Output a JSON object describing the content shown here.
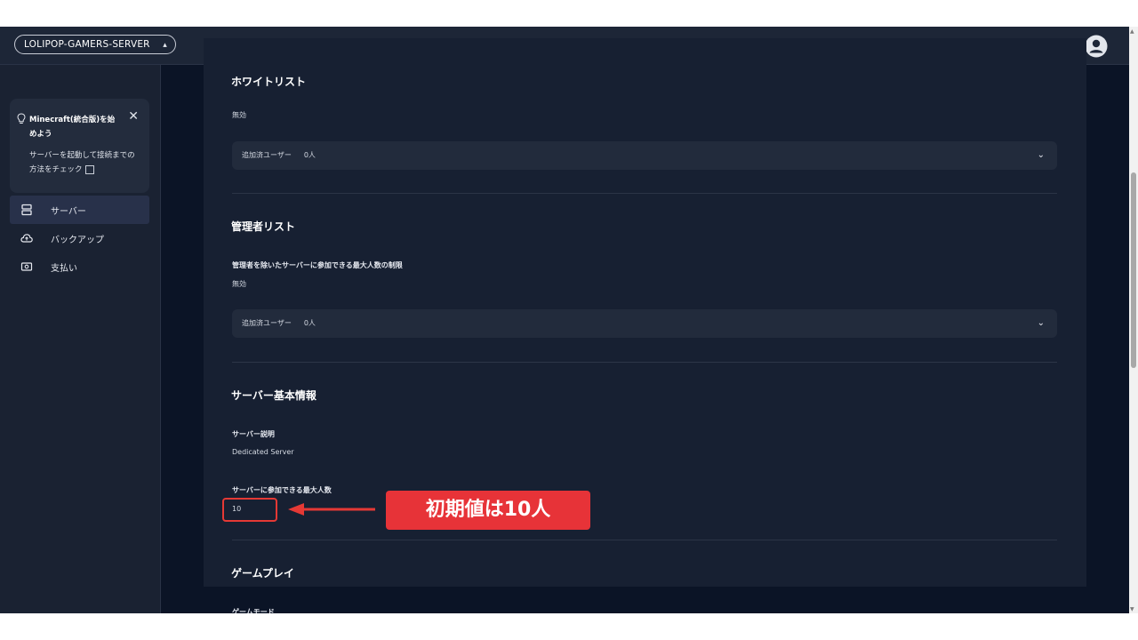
{
  "header": {
    "server_name": "LOLIPOP-GAMERS-SERVER",
    "chevron": "⌃⌄"
  },
  "sidebar": {
    "promo": {
      "title": "Minecraft(統合版)を始めよう",
      "description": "サーバーを起動して接続までの方法をチェック",
      "close": "✕"
    },
    "items": [
      {
        "label": "サーバー",
        "icon": "server-icon",
        "active": true
      },
      {
        "label": "バックアップ",
        "icon": "cloud-backup-icon",
        "active": false
      },
      {
        "label": "支払い",
        "icon": "payment-icon",
        "active": false
      }
    ]
  },
  "main": {
    "whitelist": {
      "title": "ホワイトリスト",
      "status": "無効",
      "accordion_label": "追加済ユーザー",
      "accordion_value": "0人"
    },
    "admin_list": {
      "title": "管理者リスト",
      "limit_label": "管理者を除いたサーバーに参加できる最大人数の制限",
      "status": "無効",
      "accordion_label": "追加済ユーザー",
      "accordion_value": "0人"
    },
    "server_info": {
      "title": "サーバー基本情報",
      "description_label": "サーバー説明",
      "description_value": "Dedicated Server",
      "max_players_label": "サーバーに参加できる最大人数",
      "max_players_value": "10"
    },
    "gameplay": {
      "title": "ゲームプレイ",
      "game_mode_label": "ゲームモード"
    }
  },
  "annotation": {
    "callout_text": "初期値は10人",
    "color": "#e73338"
  }
}
